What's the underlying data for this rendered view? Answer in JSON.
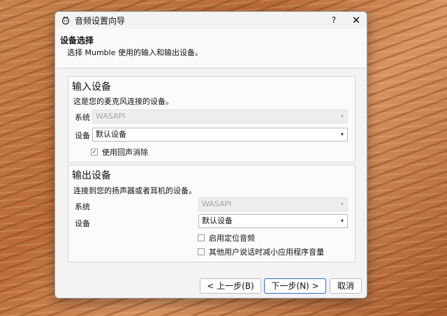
{
  "window": {
    "title": "音频设置向导",
    "help": "?",
    "close": "✕"
  },
  "header": {
    "title": "设备选择",
    "subtitle": "选择 Mumble 使用的输入和输出设备。"
  },
  "input": {
    "title": "输入设备",
    "desc": "这是您的麦克风连接的设备。",
    "system_label": "系统",
    "system_value": "WASAPI",
    "device_label": "设备",
    "device_value": "默认设备",
    "echo_cancel_label": "使用回声消除",
    "echo_cancel_checked": true
  },
  "output": {
    "title": "输出设备",
    "desc": "连接到您的扬声器或者耳机的设备。",
    "system_label": "系统",
    "system_value": "WASAPI",
    "device_label": "设备",
    "device_value": "默认设备",
    "positional_label": "启用定位音频",
    "positional_checked": false,
    "attenuate_label": "其他用户说话时减小应用程序音量",
    "attenuate_checked": false
  },
  "footer": {
    "back": "< 上一步(B)",
    "next": "下一步(N) >",
    "cancel": "取消"
  },
  "icons": {
    "checkmark": "✓",
    "dropdown": "▾"
  },
  "colors": {
    "accent": "#2a6fd1"
  }
}
